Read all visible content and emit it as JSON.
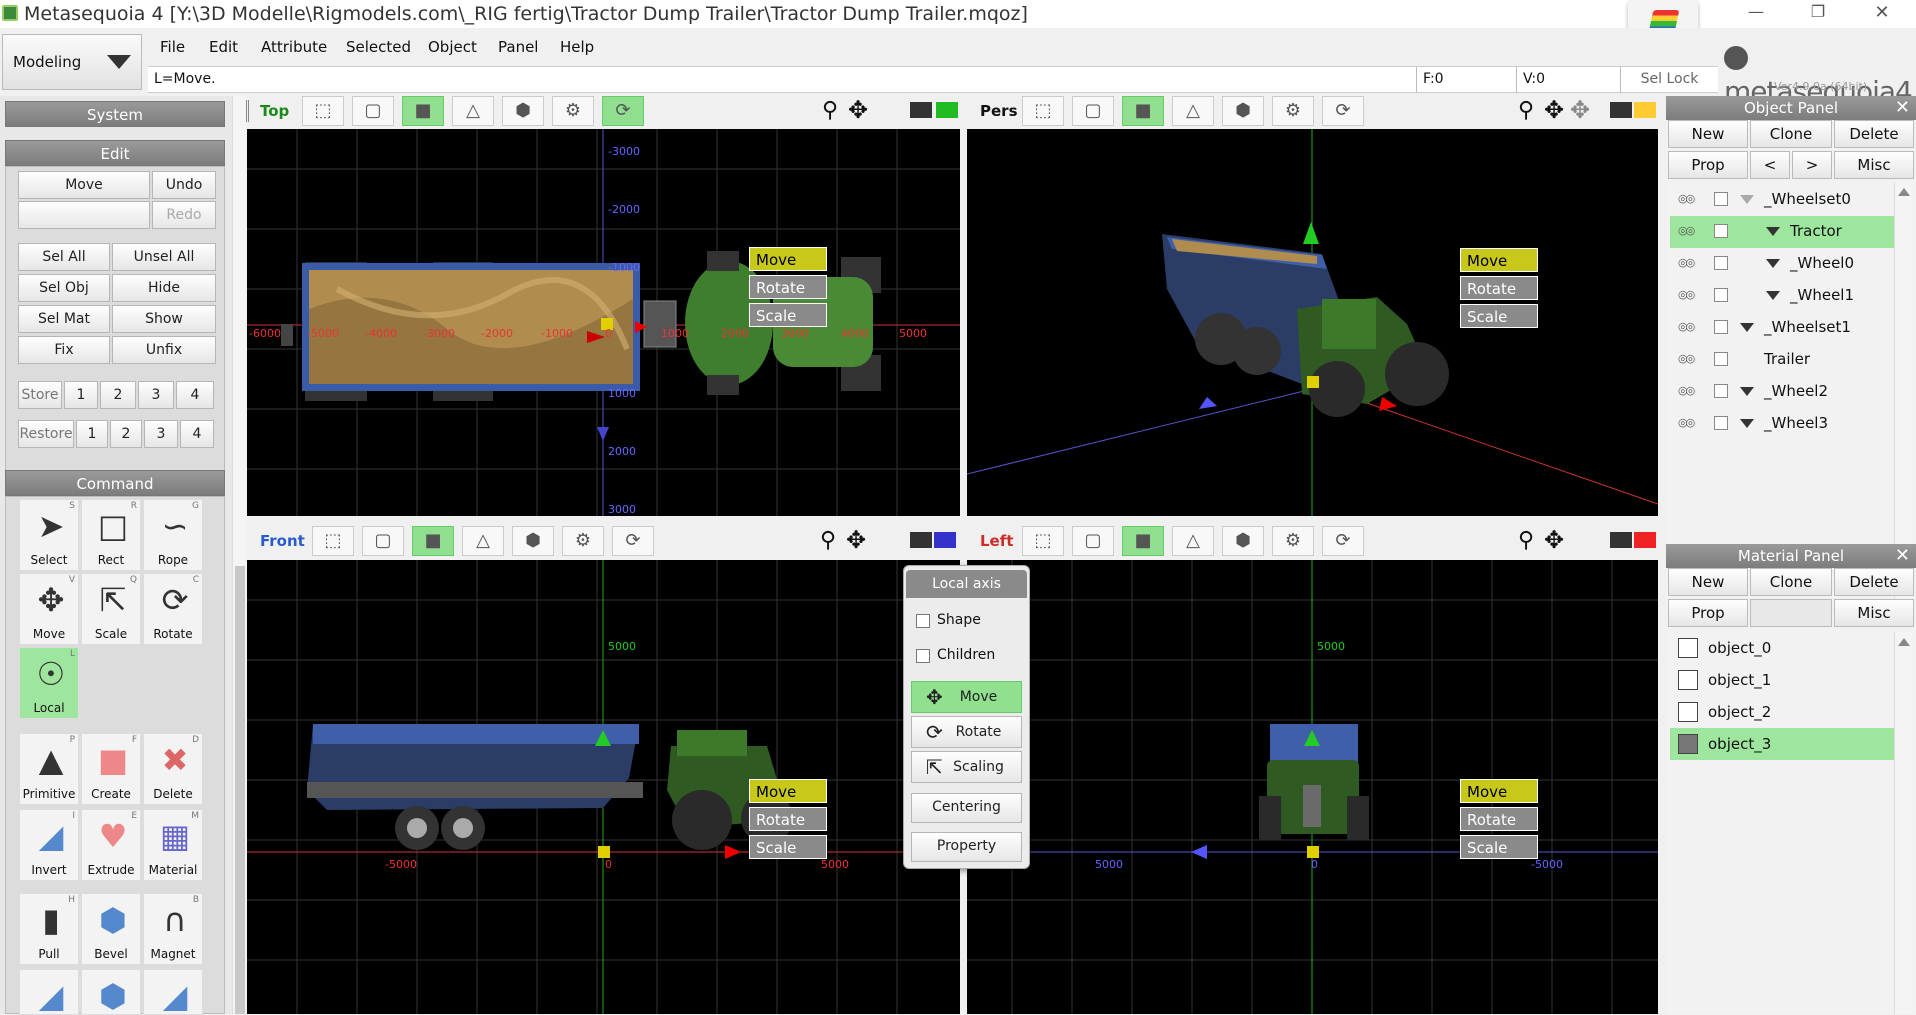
{
  "window": {
    "title": "Metasequoia 4 [Y:\\3D Modelle\\Rigmodels.com\\_RIG fertig\\Tractor Dump Trailer\\Tractor Dump Trailer.mqoz]"
  },
  "mode_selector": {
    "value": "Modeling"
  },
  "menu": [
    "File",
    "Edit",
    "Attribute",
    "Selected",
    "Object",
    "Panel",
    "Help"
  ],
  "status": {
    "hint": "L=Move.",
    "faces": "F:0",
    "vertices": "V:0",
    "sel_lock": "Sel Lock"
  },
  "brand": {
    "logo_text": "metasequoia4",
    "version": "Ver4.9.0a (64bit)"
  },
  "left_panel": {
    "system_label": "System",
    "edit_label": "Edit",
    "edit_buttons": {
      "move": "Move",
      "undo": "Undo",
      "redo": "Redo",
      "sel_all": "Sel All",
      "unsel_all": "Unsel All",
      "sel_obj": "Sel Obj",
      "hide": "Hide",
      "sel_mat": "Sel Mat",
      "show": "Show",
      "fix": "Fix",
      "unfix": "Unfix"
    },
    "store_label": "Store",
    "restore_label": "Restore",
    "slots": [
      "1",
      "2",
      "3",
      "4"
    ],
    "command_label": "Command",
    "tools": [
      {
        "label": "Select",
        "key": "S"
      },
      {
        "label": "Rect",
        "key": "R"
      },
      {
        "label": "Rope",
        "key": "G"
      },
      {
        "label": "Move",
        "key": "V"
      },
      {
        "label": "Scale",
        "key": "Q"
      },
      {
        "label": "Rotate",
        "key": "C"
      },
      {
        "label": "Local",
        "key": "L"
      },
      {
        "label": "Primitive",
        "key": "P"
      },
      {
        "label": "Create",
        "key": "F"
      },
      {
        "label": "Delete",
        "key": "D"
      },
      {
        "label": "Invert",
        "key": "I"
      },
      {
        "label": "Extrude",
        "key": "E"
      },
      {
        "label": "Material",
        "key": "M"
      },
      {
        "label": "Pull",
        "key": "H"
      },
      {
        "label": "Bevel",
        "key": ""
      },
      {
        "label": "Magnet",
        "key": "B"
      }
    ]
  },
  "viewports": {
    "top": {
      "name": "Top",
      "axis_labels": [
        "-3000",
        "-2000",
        "-1000",
        "1000",
        "2000",
        "3000",
        "-6000",
        "-5000",
        "-4000",
        "-3000",
        "-2000",
        "-1000",
        "0",
        "1000",
        "2000",
        "3000",
        "4000",
        "5000"
      ]
    },
    "pers": {
      "name": "Pers"
    },
    "front": {
      "name": "Front",
      "axis_labels": [
        "5000",
        "-5000",
        "0",
        "5000"
      ]
    },
    "left": {
      "name": "Left",
      "axis_labels": [
        "5000",
        "5000",
        "0",
        "-5000"
      ]
    },
    "handle_tags": {
      "move": "Move",
      "rotate": "Rotate",
      "scale": "Scale"
    }
  },
  "popup": {
    "title": "Local axis",
    "shape": "Shape",
    "children": "Children",
    "move": "Move",
    "rotate": "Rotate",
    "scaling": "Scaling",
    "centering": "Centering",
    "property": "Property"
  },
  "object_panel": {
    "title": "Object Panel",
    "buttons": {
      "new": "New",
      "clone": "Clone",
      "delete": "Delete",
      "prop": "Prop",
      "prev": "<",
      "next": ">",
      "misc": "Misc"
    },
    "objects": [
      {
        "name": "_Wheelset0",
        "indent": 0,
        "selected": false,
        "open": false
      },
      {
        "name": "Tractor",
        "indent": 1,
        "selected": true,
        "open": true
      },
      {
        "name": "_Wheel0",
        "indent": 2,
        "selected": false,
        "open": true
      },
      {
        "name": "_Wheel1",
        "indent": 2,
        "selected": false,
        "open": true
      },
      {
        "name": "_Wheelset1",
        "indent": 0,
        "selected": false,
        "open": true
      },
      {
        "name": "Trailer",
        "indent": 0,
        "selected": false,
        "open": false
      },
      {
        "name": "_Wheel2",
        "indent": 0,
        "selected": false,
        "open": true
      },
      {
        "name": "_Wheel3",
        "indent": 0,
        "selected": false,
        "open": true
      }
    ]
  },
  "material_panel": {
    "title": "Material Panel",
    "buttons": {
      "new": "New",
      "clone": "Clone",
      "delete": "Delete",
      "prop": "Prop",
      "misc": "Misc"
    },
    "materials": [
      {
        "name": "object_0",
        "selected": false
      },
      {
        "name": "object_1",
        "selected": false
      },
      {
        "name": "object_2",
        "selected": false
      },
      {
        "name": "object_3",
        "selected": true
      }
    ]
  },
  "colors": {
    "accent_green": "#8fdf8f",
    "viewport_bg": "#000000",
    "move_tag": "#c8c81a",
    "axis_x": "#e03030",
    "axis_y": "#30c030",
    "axis_z": "#4040e0"
  }
}
